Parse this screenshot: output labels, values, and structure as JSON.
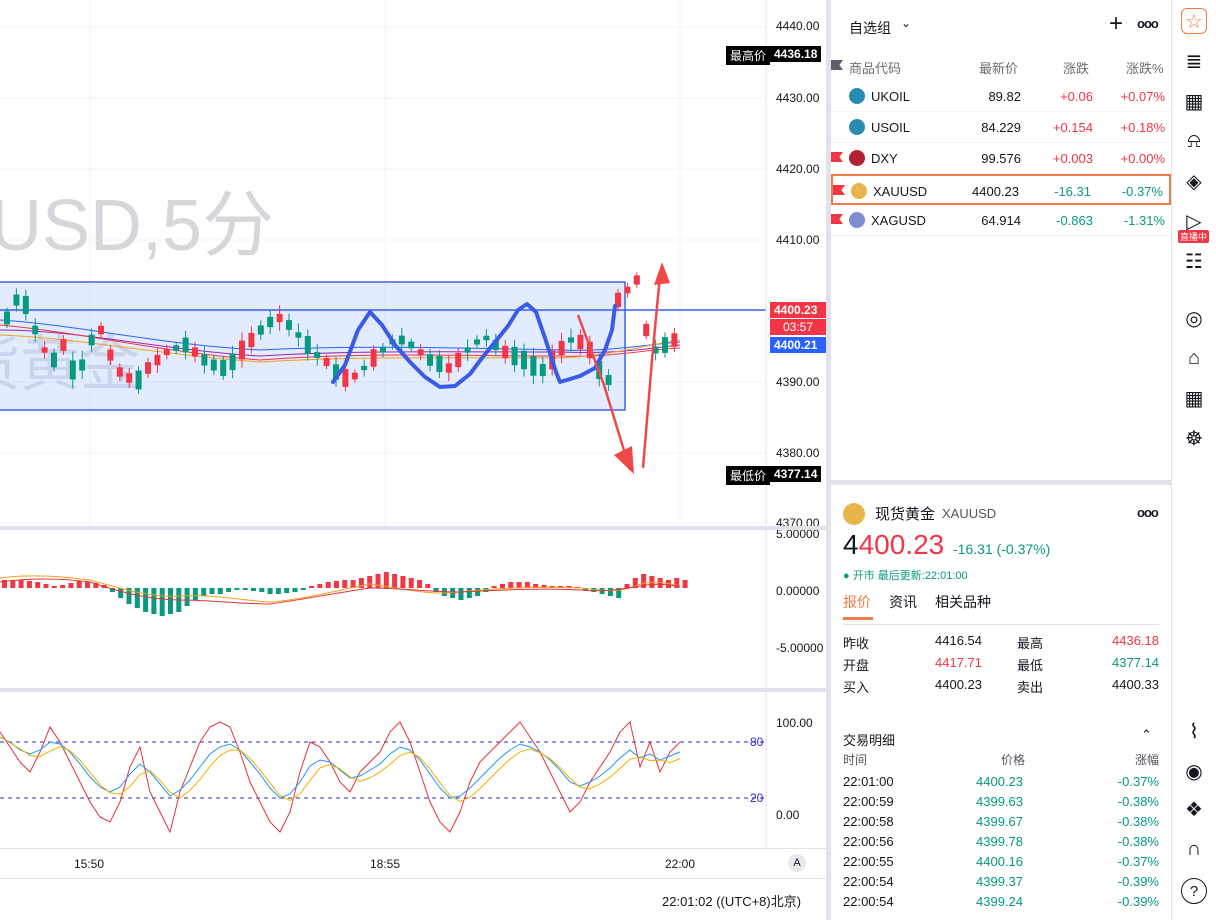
{
  "chart": {
    "watermark": "USD,5分",
    "watermark2": "货黄金",
    "price_axis": [
      "4440.00",
      "4430.00",
      "4420.00",
      "4410.00",
      "4400.00",
      "4390.00",
      "4380.00",
      "4370.00"
    ],
    "high_label": "最高价",
    "high_value": "4436.18",
    "low_label": "最低价",
    "low_value": "4377.14",
    "last_price": "4400.23",
    "countdown": "03:57",
    "bid_tag": "4400.21",
    "macd_axis": [
      "5.00000",
      "0.00000",
      "-5.00000"
    ],
    "kdj_axis": [
      "100.00",
      "0.00"
    ],
    "kdj_levels": [
      "80",
      "20"
    ],
    "time_axis": [
      "15:50",
      "18:55",
      "22:00"
    ],
    "status_time": "22:01:02 ((UTC+8)北京)",
    "auto_label": "A"
  },
  "watchlist": {
    "title": "自选组",
    "add": "+",
    "more": "ooo",
    "columns": [
      "商品代码",
      "最新价",
      "涨跌",
      "涨跌%"
    ],
    "rows": [
      {
        "symbol": "UKOIL",
        "price": "89.82",
        "change": "+0.06",
        "pct": "+0.07%",
        "dir": "up",
        "icon": "oil-icon",
        "color": "#2a8bb3"
      },
      {
        "symbol": "USOIL",
        "price": "84.229",
        "change": "+0.154",
        "pct": "+0.18%",
        "dir": "up",
        "icon": "oil-icon",
        "color": "#2a8bb3"
      },
      {
        "symbol": "DXY",
        "price": "99.576",
        "change": "+0.003",
        "pct": "+0.00%",
        "dir": "up",
        "icon": "us-flag-icon",
        "color": "#b22234"
      },
      {
        "symbol": "XAUUSD",
        "price": "4400.23",
        "change": "-16.31",
        "pct": "-0.37%",
        "dir": "dn",
        "icon": "gold-icon",
        "color": "#e8b54a"
      },
      {
        "symbol": "XAGUSD",
        "price": "64.914",
        "change": "-0.863",
        "pct": "-1.31%",
        "dir": "dn",
        "icon": "silver-icon",
        "color": "#7f8ccf"
      }
    ]
  },
  "details": {
    "name": "现货黄金",
    "symbol": "XAUUSD",
    "more": "ooo",
    "price_prefix": "4",
    "price_main": "400.23",
    "change": "-16.31 (-0.37%)",
    "market_status": "● 开市 最后更新:22:01:00",
    "tabs": [
      "报价",
      "资讯",
      "相关品种"
    ],
    "quote": [
      {
        "l1": "昨收",
        "v1": "4416.54",
        "l2": "最高",
        "v2": "4436.18",
        "c1": "",
        "c2": "up"
      },
      {
        "l1": "开盘",
        "v1": "4417.71",
        "l2": "最低",
        "v2": "4377.14",
        "c1": "up",
        "c2": "dn"
      },
      {
        "l1": "买入",
        "v1": "4400.23",
        "l2": "卖出",
        "v2": "4400.33",
        "c1": "",
        "c2": ""
      }
    ],
    "trades_title": "交易明细",
    "trades_cols": [
      "时间",
      "价格",
      "涨幅"
    ],
    "trades": [
      {
        "t": "22:01:00",
        "p": "4400.23",
        "c": "-0.37%"
      },
      {
        "t": "22:00:59",
        "p": "4399.63",
        "c": "-0.38%"
      },
      {
        "t": "22:00:58",
        "p": "4399.67",
        "c": "-0.38%"
      },
      {
        "t": "22:00:56",
        "p": "4399.78",
        "c": "-0.38%"
      },
      {
        "t": "22:00:55",
        "p": "4400.16",
        "c": "-0.37%"
      },
      {
        "t": "22:00:54",
        "p": "4399.37",
        "c": "-0.39%"
      },
      {
        "t": "22:00:54",
        "p": "4399.24",
        "c": "-0.39%"
      }
    ]
  },
  "rightbar": {
    "live_badge": "直播中",
    "icons": [
      "watchlist-icon",
      "news-icon",
      "calendar-icon",
      "alert-icon",
      "layers-icon",
      "live-video-icon",
      "chat-icon",
      "target-icon",
      "education-icon",
      "grid-icon",
      "network-icon",
      "pulse-icon",
      "drone-icon",
      "handshake-icon",
      "headset-icon",
      "help-icon"
    ],
    "help": "?"
  },
  "colors": {
    "up": "#f23645",
    "down": "#089981",
    "accent": "#f07b4a",
    "box": "#2962ff"
  }
}
